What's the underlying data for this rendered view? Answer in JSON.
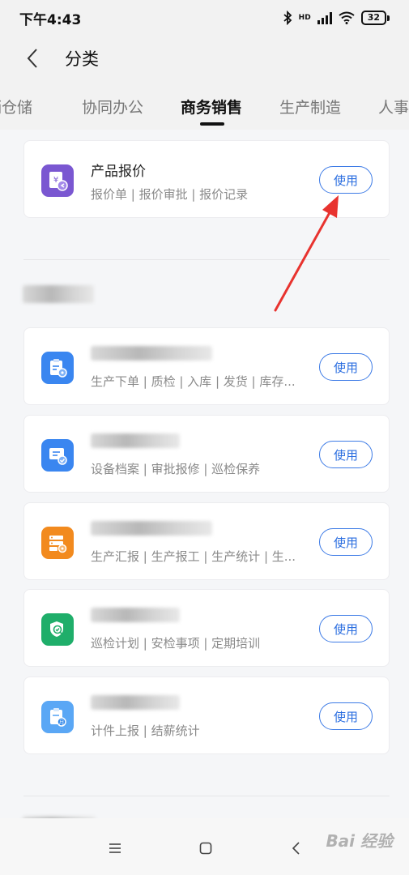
{
  "status_bar": {
    "time": "下午4:43",
    "network": "HD",
    "battery": "32"
  },
  "header": {
    "title": "分类"
  },
  "tabs": [
    {
      "label": "营销仓储"
    },
    {
      "label": "协同办公"
    },
    {
      "label": "商务销售"
    },
    {
      "label": "生产制造"
    },
    {
      "label": "人事"
    }
  ],
  "active_tab": "商务销售",
  "apps": [
    {
      "title": "产品报价",
      "desc": "报价单 | 报价审批 | 报价记录",
      "button": "使用",
      "icon": "price-quote-icon",
      "color": "#7a57d1"
    },
    {
      "title": "",
      "desc": "生产下单 | 质检 | 入库 | 发货 | 库存...",
      "button": "使用",
      "icon": "clipboard-gear-icon",
      "color": "#3a86f0"
    },
    {
      "title": "",
      "desc": "设备档案 | 审批报修 | 巡检保养",
      "button": "使用",
      "icon": "device-check-icon",
      "color": "#3a86f0"
    },
    {
      "title": "",
      "desc": "生产汇报 | 生产报工 | 生产统计 | 生...",
      "button": "使用",
      "icon": "server-gear-icon",
      "color": "#f28a1e"
    },
    {
      "title": "",
      "desc": "巡检计划 | 安检事项 | 定期培训",
      "button": "使用",
      "icon": "shield-check-icon",
      "color": "#1fae6a"
    },
    {
      "title": "",
      "desc": "计件上报 | 结薪统计",
      "button": "使用",
      "icon": "piecework-report-icon",
      "color": "#5aa7f5"
    }
  ],
  "watermark": "Bai 经验"
}
